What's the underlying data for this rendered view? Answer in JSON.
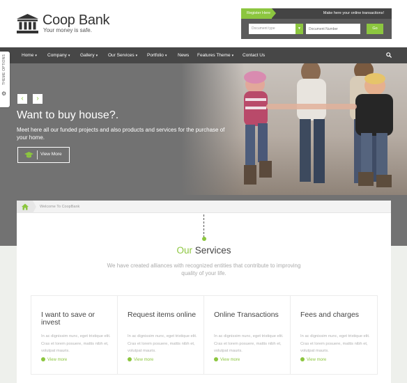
{
  "brand": {
    "name": "Coop Bank",
    "tagline": "Your money is safe."
  },
  "widget": {
    "register_label": "Register Here",
    "slogan": "Make here your online transactions!",
    "doc_type_placeholder": "Document type",
    "doc_number_placeholder": "Document Number",
    "go_label": "Go"
  },
  "nav": {
    "items": [
      {
        "label": "Home",
        "dropdown": true
      },
      {
        "label": "Company",
        "dropdown": true
      },
      {
        "label": "Gallery",
        "dropdown": true
      },
      {
        "label": "Our Services",
        "dropdown": true
      },
      {
        "label": "Portfolio",
        "dropdown": true
      },
      {
        "label": "News",
        "dropdown": false
      },
      {
        "label": "Features Theme",
        "dropdown": true
      },
      {
        "label": "Contact Us",
        "dropdown": false
      }
    ],
    "caret": "▾",
    "search_icon": "search-icon"
  },
  "theme_tab": {
    "label": "THEME OPTIONS",
    "icon": "gear-icon"
  },
  "hero": {
    "prev": "‹",
    "next": "›",
    "title": "Want to buy house?.",
    "text": "Meet here all our funded projects and also products and services for the purchase of your home.",
    "button_label": "View More",
    "button_icon": "graduation-cap-icon"
  },
  "breadcrumb": {
    "home_icon": "home-icon",
    "text": "Welcome To CoopBank"
  },
  "services": {
    "title_accent": "Our",
    "title_rest": "Services",
    "subtitle": "We have created alliances with recognized entities that contribute to improving quality of your life.",
    "cards": [
      {
        "title": "I want to save or invest",
        "text": "In ac dignissim nunc, eget tristique elit. Cras et lorem posuere, mattis nibh et, volutpat mauris.",
        "link": "View more"
      },
      {
        "title": "Request items online",
        "text": "In ac dignissim nunc, eget tristique elit. Cras et lorem posuere, mattis nibh et, volutpat mauris.",
        "link": "View more"
      },
      {
        "title": "Online Transactions",
        "text": "In ac dignissim nunc, eget tristique elit. Cras et lorem posuere, mattis nibh et, volutpat mauris.",
        "link": "View more"
      },
      {
        "title": "Fees and charges",
        "text": "In ac dignissim nunc, eget tristique elit. Cras et lorem posuere, mattis nibh et, volutpat mauris.",
        "link": "View more"
      }
    ]
  },
  "colors": {
    "accent": "#8cc63f",
    "nav_bg": "#474747",
    "hero_bg": "#727272"
  }
}
